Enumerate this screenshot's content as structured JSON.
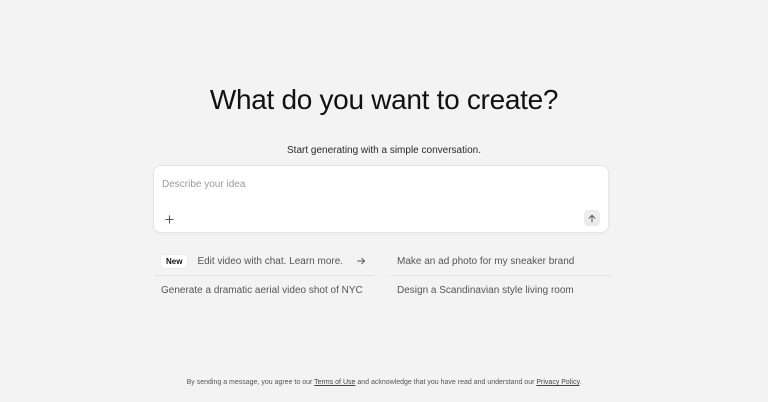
{
  "hero": {
    "title": "What do you want to create?",
    "subtitle": "Start generating with a simple conversation."
  },
  "composer": {
    "placeholder": "Describe your idea",
    "value": "",
    "add_icon": "plus-icon",
    "send_icon": "arrow-up-icon"
  },
  "suggestions": {
    "left": [
      {
        "badge": "New",
        "label": "Edit video with chat. Learn more.",
        "icon": "arrow-right-icon"
      },
      {
        "label": "Generate a dramatic aerial video shot of NYC"
      }
    ],
    "right": [
      {
        "label": "Make an ad photo for my sneaker brand"
      },
      {
        "label": "Design a Scandinavian style living room"
      }
    ]
  },
  "footer": {
    "prefix": "By sending a message, you agree to our",
    "terms_link": "Terms of Use",
    "middle": "and acknowledge that you have read and understand our",
    "privacy_link": "Privacy Policy",
    "suffix": "."
  },
  "colors": {
    "background": "#f3f3f3",
    "card": "#ffffff",
    "text": "#111111",
    "muted": "#555555"
  }
}
